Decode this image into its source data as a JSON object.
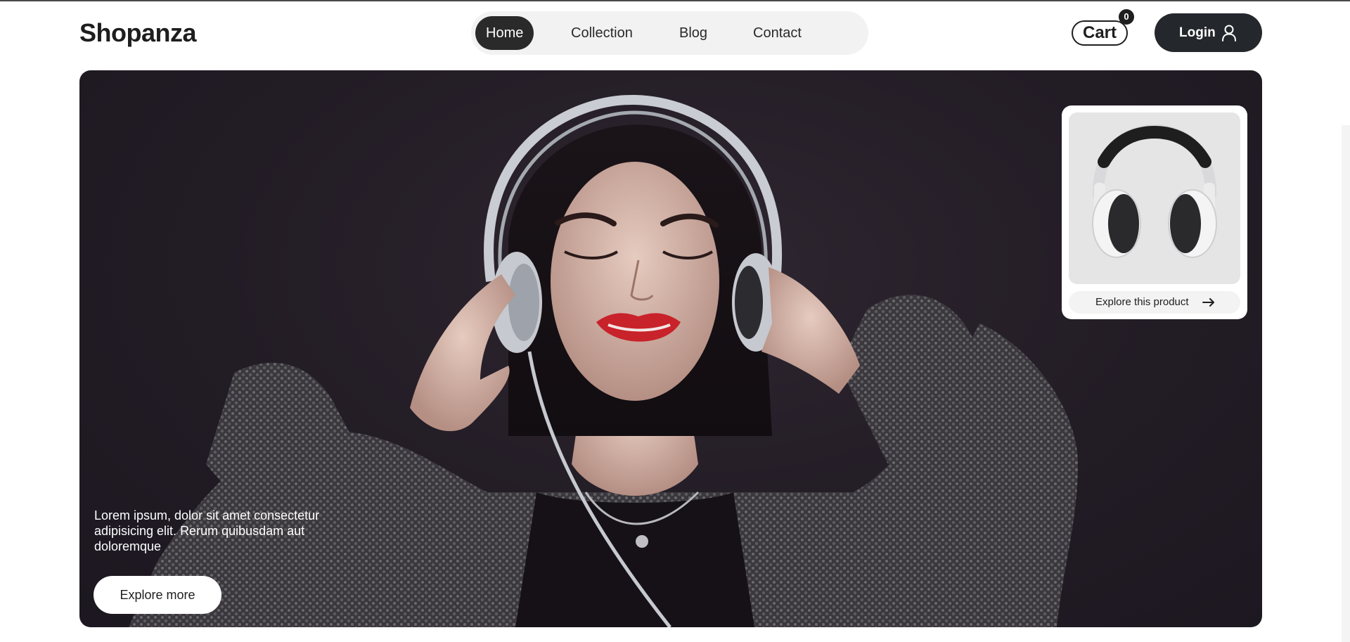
{
  "brand": {
    "name": "Shopanza"
  },
  "nav": {
    "items": [
      {
        "label": "Home",
        "active": true
      },
      {
        "label": "Collection",
        "active": false
      },
      {
        "label": "Blog",
        "active": false
      },
      {
        "label": "Contact",
        "active": false
      }
    ]
  },
  "cart": {
    "label": "Cart",
    "count": "0"
  },
  "login": {
    "label": "Login",
    "icon": "user-icon"
  },
  "hero": {
    "text": "Lorem ipsum, dolor sit amet consectetur adipisicing elit. Rerum quibusdam aut doloremque",
    "cta": "Explore more"
  },
  "product_card": {
    "link_label": "Explore this product",
    "icon": "arrow-right-icon"
  },
  "colors": {
    "dark": "#24272b",
    "hero_bg": "#221c25",
    "nav_bg": "#f2f2f3",
    "white": "#ffffff",
    "lips": "#c8222a"
  }
}
